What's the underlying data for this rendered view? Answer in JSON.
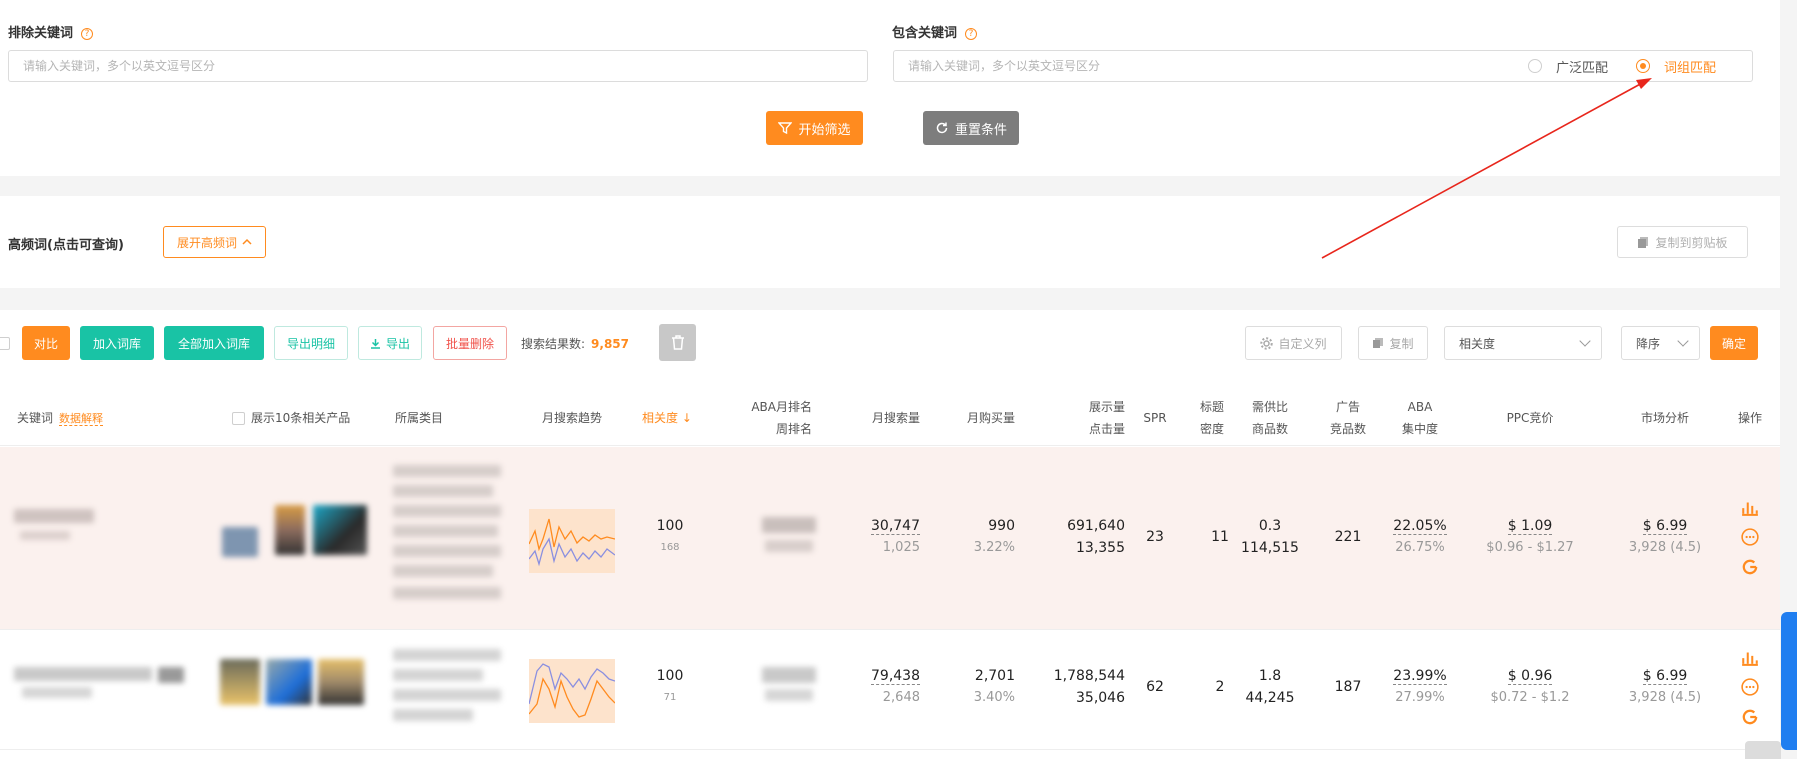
{
  "filters": {
    "exclude": {
      "label": "排除关键词",
      "placeholder": "请输入关键词，多个以英文逗号区分"
    },
    "include": {
      "label": "包含关键词",
      "placeholder": "请输入关键词，多个以英文逗号区分"
    },
    "match": {
      "options": [
        "广泛匹配",
        "词组匹配"
      ],
      "selected": "词组匹配"
    },
    "start_button": "开始筛选",
    "reset_button": "重置条件"
  },
  "hot_words": {
    "title": "高频词(点击可查询)",
    "expand_button": "展开高频词",
    "copy_button": "复制到剪贴板"
  },
  "toolbar": {
    "compare": "对比",
    "add_lib": "加入词库",
    "add_all_lib": "全部加入词库",
    "export_detail": "导出明细",
    "export": "导出",
    "batch_delete": "批量删除",
    "result_label": "搜索结果数:",
    "result_count": "9,857",
    "custom_columns": "自定义列",
    "copy": "复制",
    "sort_field": "相关度",
    "sort_order": "降序",
    "confirm": "确定"
  },
  "columns": {
    "keyword": "关键词",
    "data_explain": "数据解释",
    "show_products": "展示10条相关产品",
    "category": "所属类目",
    "trend": "月搜索趋势",
    "relevance": "相关度",
    "aba_monthly": "ABA月排名",
    "aba_weekly": "周排名",
    "monthly_search": "月搜索量",
    "monthly_purchase": "月购买量",
    "impressions": "展示量",
    "clicks": "点击量",
    "spr": "SPR",
    "title_density_1": "标题",
    "title_density_2": "密度",
    "supply_ratio": "需供比",
    "product_count": "商品数",
    "ad_1": "广告",
    "ad_2": "竞品数",
    "aba_1": "ABA",
    "aba_2": "集中度",
    "ppc": "PPC竞价",
    "market": "市场分析",
    "ops": "操作"
  },
  "rows": [
    {
      "relevance": "100",
      "relevance_sub": "168",
      "monthly_search": "30,747",
      "monthly_search_sub": "1,025",
      "monthly_purchase": "990",
      "purchase_rate": "3.22%",
      "impressions": "691,640",
      "clicks": "13,355",
      "spr": "23",
      "title_density": "11",
      "supply_ratio": "0.3",
      "product_count": "114,515",
      "ad_count": "221",
      "aba_conc": "22.05%",
      "aba_conc_sub": "26.75%",
      "ppc": "$ 1.09",
      "ppc_range": "$0.96 - $1.27",
      "market_price": "$ 6.99",
      "market_reviews": "3,928 (4.5)"
    },
    {
      "relevance": "100",
      "relevance_sub": "71",
      "monthly_search": "79,438",
      "monthly_search_sub": "2,648",
      "monthly_purchase": "2,701",
      "purchase_rate": "3.40%",
      "impressions": "1,788,544",
      "clicks": "35,046",
      "spr": "62",
      "title_density": "2",
      "supply_ratio": "1.8",
      "product_count": "44,245",
      "ad_count": "187",
      "aba_conc": "23.99%",
      "aba_conc_sub": "27.99%",
      "ppc": "$ 0.96",
      "ppc_range": "$0.72 - $1.2",
      "market_price": "$ 6.99",
      "market_reviews": "3,928 (4.5)"
    }
  ],
  "colors": {
    "accent": "#ff8b1f",
    "teal": "#19c3a5",
    "red": "#f0524b",
    "row_highlight": "#fbf1ee",
    "arrow": "#e8261c"
  }
}
